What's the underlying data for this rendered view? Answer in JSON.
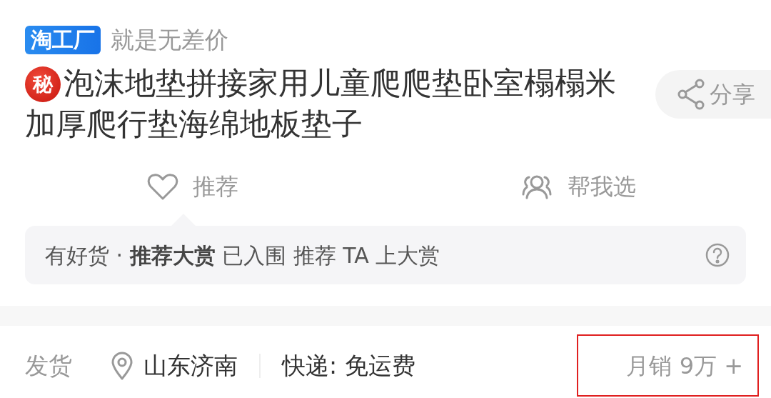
{
  "brand_badge": "淘工厂",
  "slogan": "就是无差价",
  "secret_badge": "秘",
  "title": "泡沫地垫拼接家用儿童爬爬垫卧室榻榻米加厚爬行垫海绵地板垫子",
  "share_button": "分享",
  "actions": [
    {
      "kind": "recommend",
      "label": "推荐"
    },
    {
      "kind": "help_choose",
      "label": "帮我选"
    }
  ],
  "notice": {
    "text": "有好货 · **推荐大赏** 已入围 推荐 TA 上大赏"
  },
  "shipping": {
    "label": "发货",
    "location": "山东济南",
    "delivery": "快递: 免运费",
    "monthly_sales": "月销 9万 +",
    "highlighted": true
  }
}
